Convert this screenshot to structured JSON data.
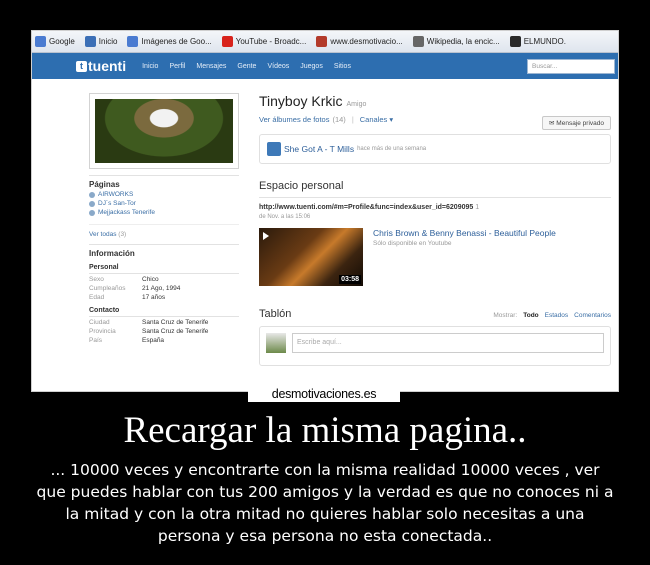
{
  "browser": {
    "bookmarks": [
      {
        "label": "Google",
        "icon": "google-icon",
        "color": "#4a7bd1"
      },
      {
        "label": "Inicio",
        "icon": "home-icon",
        "color": "#3b6fb6"
      },
      {
        "label": "Imágenes de Goo...",
        "icon": "images-icon",
        "color": "#4a7bd1"
      },
      {
        "label": "YouTube - Broadc...",
        "icon": "youtube-icon",
        "color": "#d8231c"
      },
      {
        "label": "www.desmotivacio...",
        "icon": "page-icon",
        "color": "#b33a2a"
      },
      {
        "label": "Wikipedia, la encic...",
        "icon": "wikipedia-icon",
        "color": "#666666"
      },
      {
        "label": "ELMUNDO.",
        "icon": "news-icon",
        "color": "#2a2a2a"
      }
    ]
  },
  "tuenti": {
    "logo": "tuenti",
    "nav": [
      "Inicio",
      "Perfil",
      "Mensajes",
      "Gente",
      "Vídeos",
      "Juegos",
      "Sitios"
    ],
    "search_placeholder": "Buscar...",
    "brand_color": "#2d6eb0"
  },
  "sidebar": {
    "pages_heading": "Páginas",
    "pages": [
      "AIRWORKS",
      "DJ´s San-Tor",
      "Mejjackass Tenerife"
    ],
    "see_all": "Ver todas",
    "see_all_count": "(3)",
    "info_heading": "Información",
    "personal_heading": "Personal",
    "personal": [
      {
        "k": "Sexo",
        "v": "Chico"
      },
      {
        "k": "Cumpleaños",
        "v": "21 Ago, 1994"
      },
      {
        "k": "Edad",
        "v": "17 años"
      }
    ],
    "contact_heading": "Contacto",
    "contact": [
      {
        "k": "Ciudad",
        "v": "Santa Cruz de Tenerife"
      },
      {
        "k": "Provincia",
        "v": "Santa Cruz de Tenerife"
      },
      {
        "k": "País",
        "v": "España"
      }
    ]
  },
  "profile": {
    "name": "Tinyboy Krkic",
    "tag": "Amigo",
    "photos_link": "Ver álbumes de fotos",
    "photos_count": "(14)",
    "channels": "Canales ▾",
    "message_button": "✉ Mensaje privado",
    "status_text": "She Got A - T Mills",
    "status_time": "hace más de una semana"
  },
  "personal_space": {
    "heading": "Espacio personal",
    "url": "http://www.tuenti.com/#m=Profile&func=index&user_id=6209095",
    "url_suffix": "1",
    "date": "de Nov. a las 15:06",
    "video_title": "Chris Brown & Benny Benassi - Beautiful People",
    "video_desc": "Sólo disponible en Youtube",
    "video_duration": "03:58"
  },
  "wall": {
    "heading": "Tablón",
    "show_label": "Mostrar:",
    "filters": [
      "Todo",
      "Estados",
      "Comentarios"
    ],
    "active_filter": "Todo",
    "composer_placeholder": "Escribe aquí..."
  },
  "poster": {
    "watermark": "desmotivaciones.es",
    "title": "Recargar la misma pagina..",
    "caption": "... 10000 veces y encontrarte con la misma realidad 10000 veces , ver que puedes hablar con tus 200 amigos y la verdad es que no conoces ni a la mitad y con la otra mitad no quieres hablar solo necesitas a una persona y esa persona no esta conectada.."
  }
}
